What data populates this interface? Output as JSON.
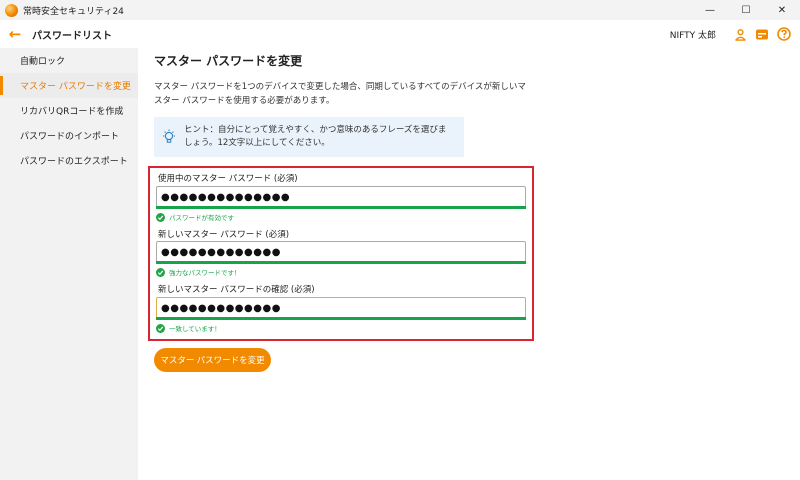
{
  "window": {
    "title": "常時安全セキュリティ24",
    "controls": {
      "minimize": "—",
      "maximize": "☐",
      "close": "✕"
    }
  },
  "header": {
    "back_icon": "←",
    "title": "パスワードリスト",
    "user_name": "NIFTY 太郎",
    "icons": [
      "user-icon",
      "card-icon",
      "help-icon"
    ]
  },
  "sidebar": {
    "items": [
      {
        "label": "自動ロック",
        "active": false
      },
      {
        "label": "マスター パスワードを変更",
        "active": true
      },
      {
        "label": "リカバリQRコードを作成",
        "active": false
      },
      {
        "label": "パスワードのインポート",
        "active": false
      },
      {
        "label": "パスワードのエクスポート",
        "active": false
      }
    ]
  },
  "main": {
    "title": "マスター パスワードを変更",
    "description": "マスター パスワードを1つのデバイスで変更した場合、同期しているすべてのデバイスが新しいマスター パスワードを使用する必要があります。",
    "hint": "ヒント：自分にとって覚えやすく、かつ意味のあるフレーズを選びましょう。12文字以上にしてください。",
    "fields": [
      {
        "label": "使用中のマスター パスワード (必須)",
        "value": "●●●●●●●●●●●●●●",
        "status": "パスワードが有効です"
      },
      {
        "label": "新しいマスター パスワード (必須)",
        "value": "●●●●●●●●●●●●●",
        "status": "強力なパスワードです！"
      },
      {
        "label": "新しいマスター パスワードの確認 (必須)",
        "value": "●●●●●●●●●●●●●",
        "status": "一致しています！"
      }
    ],
    "submit_label": "マスター パスワードを変更"
  },
  "colors": {
    "accent": "#f28a00",
    "success": "#16a34a",
    "highlight_border": "#d7262f",
    "hint_bg": "#eaf3fb",
    "sidebar_bg": "#f2f2f2"
  }
}
